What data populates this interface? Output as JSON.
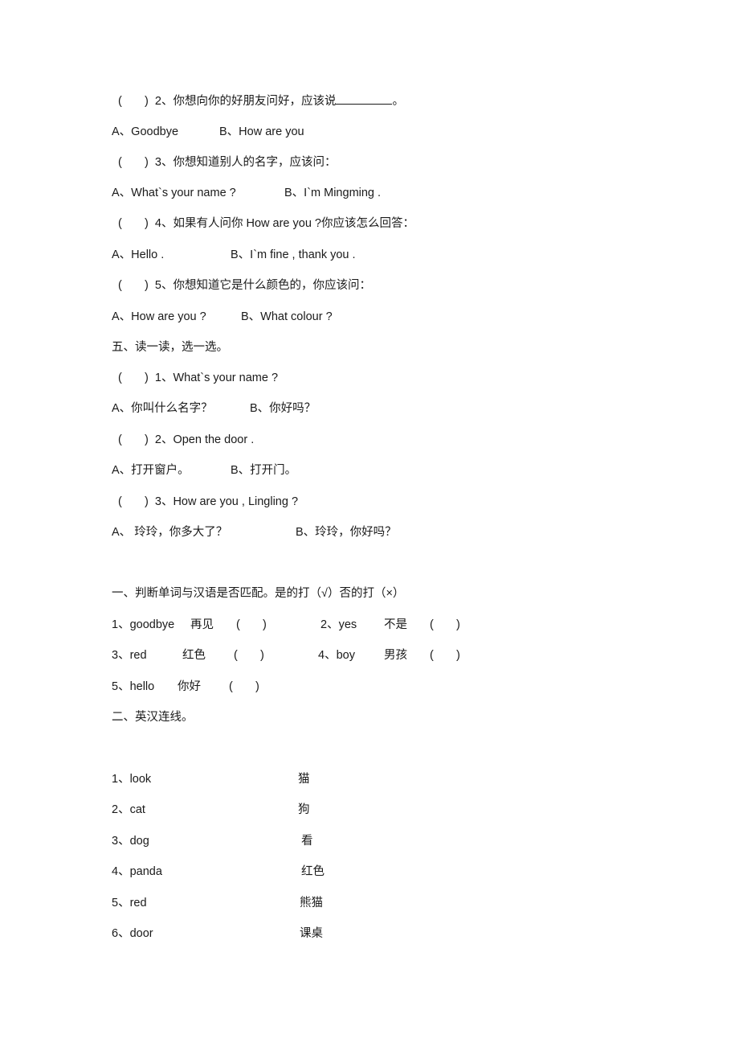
{
  "part4": {
    "questions": [
      {
        "paren": "(       )",
        "text": "2、你想向你的好朋友问好，应该说",
        "tail": "。",
        "options": [
          "A、Goodbye",
          "B、How are you"
        ]
      },
      {
        "paren": "(       )",
        "text": "3、你想知道别人的名字，应该问：",
        "options": [
          "A、What`s your name ?",
          "B、I`m Mingming ."
        ]
      },
      {
        "paren": "(       )",
        "text": "4、如果有人问你 How are you ?你应该怎么回答：",
        "options": [
          "A、Hello .",
          "B、I`m fine , thank you ."
        ]
      },
      {
        "paren": "(       )",
        "text": "5、你想知道它是什么颜色的，你应该问：",
        "options": [
          "A、How are you ?",
          "B、What colour ?"
        ]
      }
    ]
  },
  "part5": {
    "heading": "五、读一读，选一选。",
    "questions": [
      {
        "paren": "(       )",
        "text": "1、What`s your name ?",
        "options": [
          "A、你叫什么名字？",
          "B、你好吗？"
        ]
      },
      {
        "paren": "(       )",
        "text": "2、Open the door .",
        "options": [
          "A、打开窗户。",
          "B、打开门。"
        ]
      },
      {
        "paren": "(       )",
        "text": "3、How are you , Lingling ?",
        "options": [
          "A、 玲玲，你多大了？",
          "B、玲玲，你好吗？"
        ]
      }
    ]
  },
  "section1": {
    "heading": "一、判断单词与汉语是否匹配。是的打（√）否的打（×）",
    "items": [
      {
        "word": "1、goodbye",
        "meaning": "再见",
        "paren": "(       )"
      },
      {
        "word": "2、yes",
        "meaning": "不是",
        "paren": "(       )"
      },
      {
        "word": "3、red",
        "meaning": "红色",
        "paren": "(       )"
      },
      {
        "word": "4、boy",
        "meaning": "男孩",
        "paren": "(       )"
      },
      {
        "word": "5、hello",
        "meaning": "你好",
        "paren": "(       )"
      }
    ]
  },
  "section2": {
    "heading": "二、英汉连线。",
    "english": [
      "1、look",
      "2、cat",
      "3、dog",
      "4、panda",
      "5、red",
      "6、door"
    ],
    "chinese": [
      "猫",
      "狗",
      "看",
      "红色",
      "熊猫",
      "课桌"
    ]
  }
}
